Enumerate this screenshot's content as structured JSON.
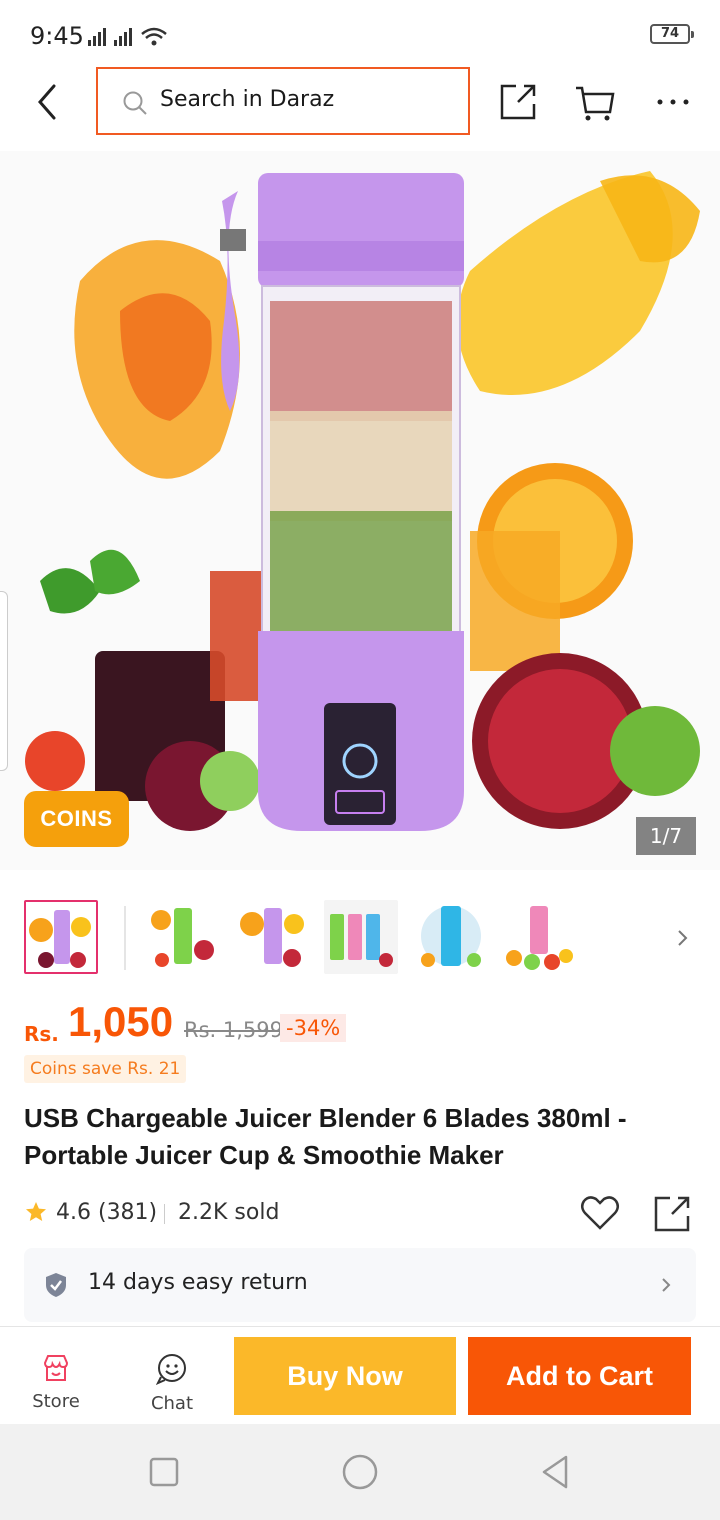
{
  "status_bar": {
    "time": "9:45",
    "battery": "74"
  },
  "header": {
    "search_placeholder": "Search in Daraz"
  },
  "hero": {
    "badge": "COINS",
    "image_counter": "1/7"
  },
  "thumbnails": {
    "count": 6,
    "active_index": 0
  },
  "price": {
    "currency": "Rs.",
    "current": "1,050",
    "original": "Rs. 1,599",
    "discount": "-34%",
    "coins_save": "Coins save Rs. 21"
  },
  "product": {
    "title": "USB Chargeable Juicer Blender 6 Blades 380ml - Portable Juicer Cup & Smoothie Maker",
    "rating": "4.6 (381)",
    "sold": "2.2K sold"
  },
  "return_policy": {
    "text": "14 days easy return"
  },
  "action_bar": {
    "store_label": "Store",
    "chat_label": "Chat",
    "buy_now_label": "Buy Now",
    "add_to_cart_label": "Add to Cart"
  },
  "colors": {
    "accent": "#f85606",
    "buy_now": "#fbb829",
    "coins": "#f5a00c",
    "active_thumb": "#e4306c"
  }
}
